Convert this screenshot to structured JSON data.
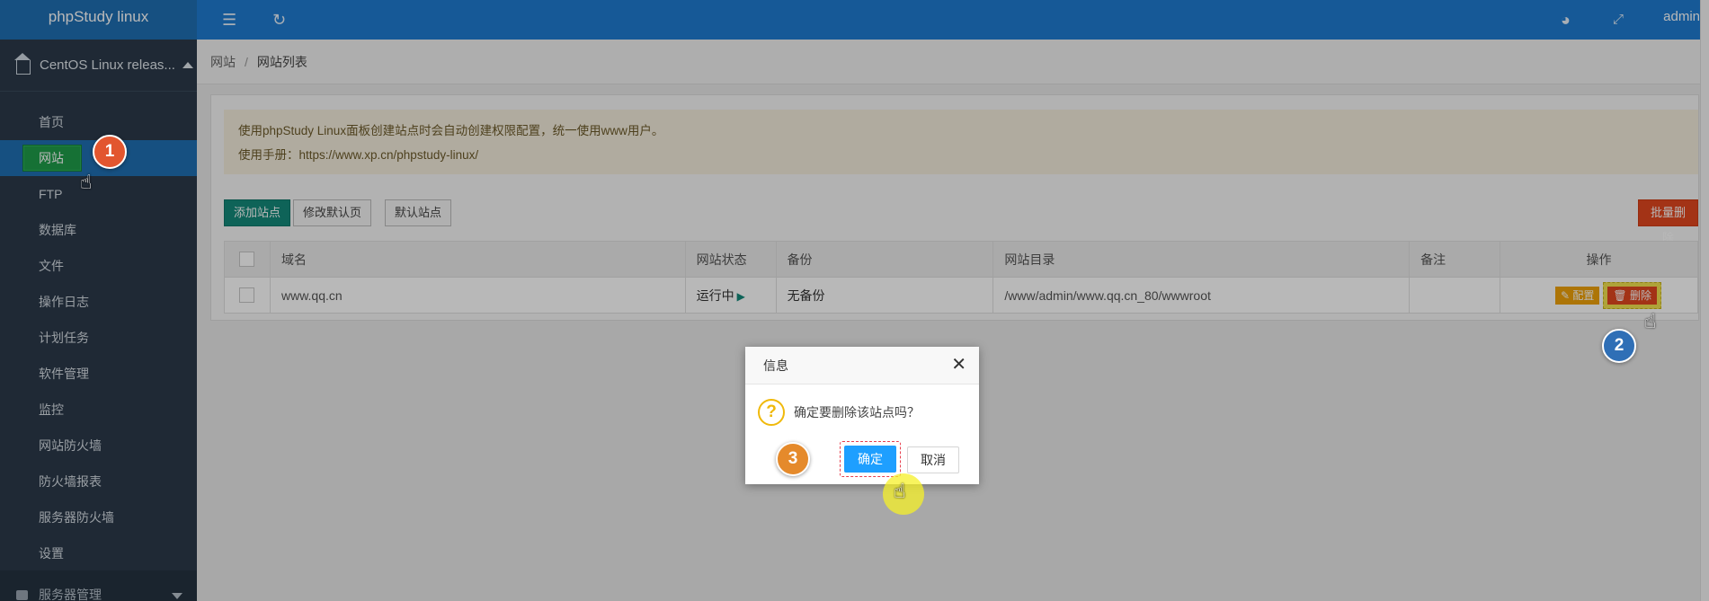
{
  "app": {
    "logo": "phpStudy linux",
    "user": "admin"
  },
  "sidebar": {
    "host_label": "CentOS Linux releas...",
    "items": [
      {
        "label": "首页"
      },
      {
        "label": "网站",
        "active": true
      },
      {
        "label": "FTP"
      },
      {
        "label": "数据库"
      },
      {
        "label": "文件"
      },
      {
        "label": "操作日志"
      },
      {
        "label": "计划任务"
      },
      {
        "label": "软件管理"
      },
      {
        "label": "监控"
      },
      {
        "label": "网站防火墙"
      },
      {
        "label": "防火墙报表"
      },
      {
        "label": "服务器防火墙"
      },
      {
        "label": "设置"
      }
    ],
    "bottom_group": "服务器管理"
  },
  "header_icons": [
    "menu-collapse-icon",
    "refresh-icon",
    "palette-icon",
    "fullscreen-icon"
  ],
  "breadcrumb": {
    "root": "网站",
    "sep": "/",
    "current": "网站列表"
  },
  "notice": {
    "line1": "使用phpStudy Linux面板创建站点时会自动创建权限配置，统一使用www用户。",
    "line2": "使用手册：https://www.xp.cn/phpstudy-linux/"
  },
  "toolbar": {
    "add": "添加站点",
    "modify_default": "修改默认页",
    "default_site": "默认站点",
    "batch_delete": "批量删除"
  },
  "table": {
    "headers": [
      "域名",
      "网站状态",
      "备份",
      "网站目录",
      "备注",
      "操作"
    ],
    "rows": [
      {
        "domain": "www.qq.cn",
        "status": "运行中",
        "backup": "无备份",
        "dir": "/www/admin/www.qq.cn_80/wwwroot",
        "note": "",
        "config": "配置",
        "delete": "删除"
      }
    ]
  },
  "dialog": {
    "title": "信息",
    "message": "确定要删除该站点吗？",
    "ok": "确定",
    "cancel": "取消",
    "close": "✕"
  },
  "markers": {
    "m1": "1",
    "m2": "2",
    "m3": "3"
  },
  "colors": {
    "header": "#1f7cd1",
    "sidebar": "#2b3a4a",
    "accent_green": "#14897a",
    "danger": "#e2471f",
    "ok_blue": "#1e9fff"
  }
}
